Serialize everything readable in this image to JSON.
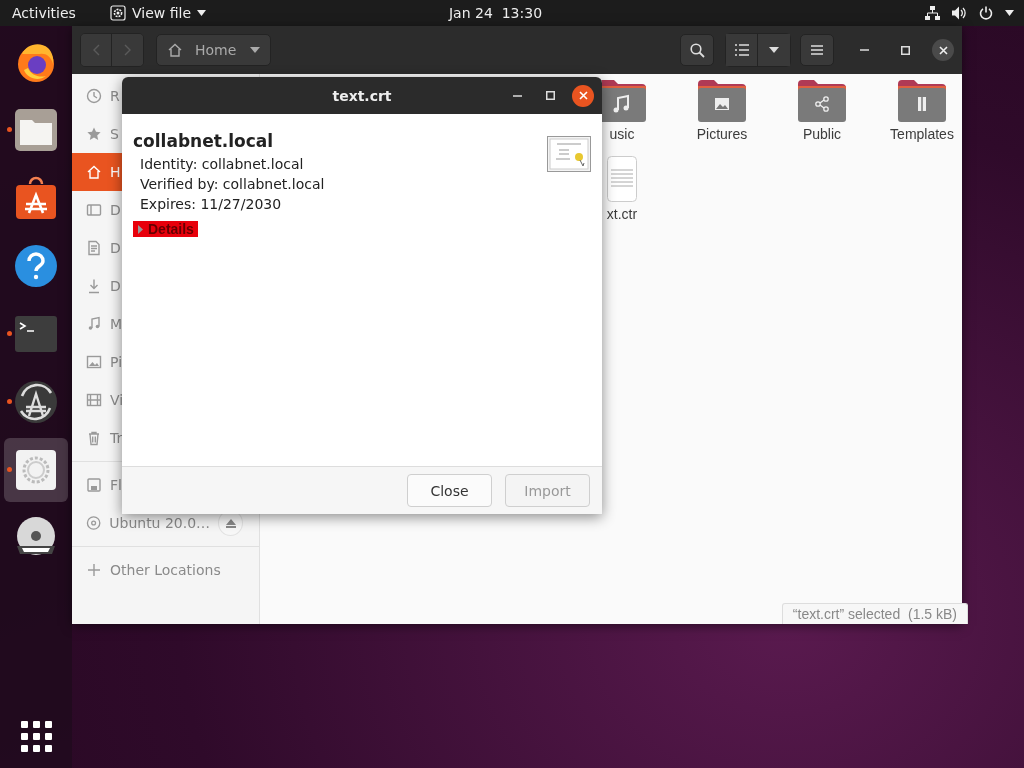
{
  "top_bar": {
    "activities": "Activities",
    "app_menu": "View file",
    "clock": "Jan 24  13:30"
  },
  "dock": {
    "items": [
      {
        "kind": "browser",
        "running": false,
        "selected": false
      },
      {
        "kind": "files",
        "running": true,
        "selected": false
      },
      {
        "kind": "software",
        "running": false,
        "selected": false
      },
      {
        "kind": "help",
        "running": false,
        "selected": false
      },
      {
        "kind": "terminal",
        "running": true,
        "selected": false
      },
      {
        "kind": "updater",
        "running": true,
        "selected": false
      },
      {
        "kind": "settings",
        "running": true,
        "selected": true
      },
      {
        "kind": "disc",
        "running": false,
        "selected": false
      }
    ]
  },
  "files_window": {
    "path": "Home",
    "sidebar": {
      "groups": [
        {
          "items": [
            {
              "kind": "recent",
              "label": "R",
              "selected": false
            },
            {
              "kind": "starred",
              "label": "S",
              "selected": false
            },
            {
              "kind": "home",
              "label": "H",
              "selected": true
            },
            {
              "kind": "desktop",
              "label": "D",
              "selected": false
            },
            {
              "kind": "documents",
              "label": "D",
              "selected": false
            },
            {
              "kind": "downloads",
              "label": "D",
              "selected": false
            },
            {
              "kind": "music",
              "label": "M",
              "selected": false
            },
            {
              "kind": "pictures",
              "label": "Pi",
              "selected": false
            },
            {
              "kind": "videos",
              "label": "Vi",
              "selected": false
            },
            {
              "kind": "trash",
              "label": "Tr",
              "selected": false
            }
          ]
        },
        {
          "items": [
            {
              "kind": "drive",
              "label": "Fl",
              "selected": false
            },
            {
              "kind": "disc",
              "label": "Ubuntu 20.0…",
              "selected": false,
              "eject": true
            }
          ]
        },
        {
          "items": [
            {
              "kind": "other",
              "label": "Other Locations",
              "selected": false
            }
          ]
        }
      ]
    },
    "rows": [
      [
        {
          "kind": "music",
          "label": "usic"
        },
        {
          "kind": "pictures",
          "label": "Pictures"
        },
        {
          "kind": "public",
          "label": "Public"
        },
        {
          "kind": "templates",
          "label": "Templates"
        }
      ],
      [
        {
          "kind": "file",
          "label": "xt.ctr"
        }
      ]
    ],
    "status": "“text.crt” selected  (1.5 kB)"
  },
  "dialog": {
    "title": "text.crt",
    "subject": "collabnet.local",
    "fields": [
      "Identity: collabnet.local",
      "Verified by: collabnet.local",
      "Expires: 11/27/2030"
    ],
    "details": {
      "label": "Details",
      "expanded": false,
      "highlighted": true
    },
    "buttons": [
      {
        "label": "Close",
        "disabled": false
      },
      {
        "label": "Import",
        "disabled": true
      }
    ]
  }
}
